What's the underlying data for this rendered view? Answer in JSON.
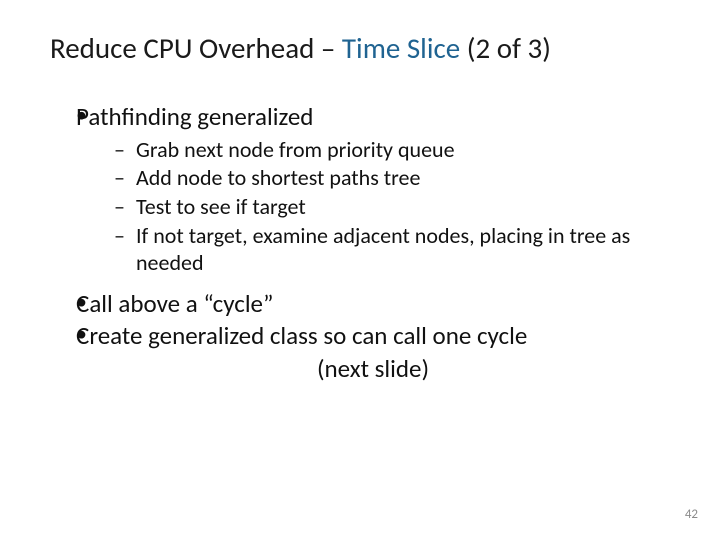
{
  "title": {
    "part1": "Reduce CPU Overhead ",
    "dash": "– ",
    "accent": "Time Slice ",
    "part2": "(2 of 3)"
  },
  "bullets": {
    "b1": "Pathfinding generalized",
    "b1_sub": [
      "Grab next node from priority queue",
      "Add node to shortest paths tree",
      "Test to see if target",
      "If not target, examine adjacent nodes, placing in tree as needed"
    ],
    "b2": "Call above a “cycle”",
    "b3": "Create generalized class so can call one cycle",
    "b3_sub_centered": "(next slide)"
  },
  "page_number": "42"
}
